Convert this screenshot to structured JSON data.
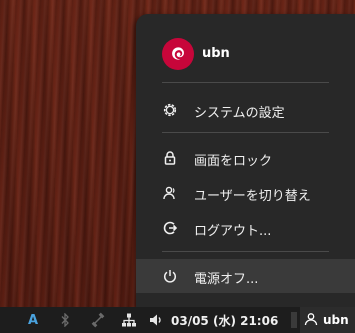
{
  "menu": {
    "user": {
      "name": "ubn",
      "avatar_icon": "debian-swirl-icon",
      "avatar_color": "#c7063a"
    },
    "items": [
      {
        "label": "システムの設定",
        "icon": "settings-gear-icon"
      },
      {
        "label": "画面をロック",
        "icon": "lock-icon"
      },
      {
        "label": "ユーザーを切り替え",
        "icon": "switch-user-icon"
      },
      {
        "label": "ログアウト...",
        "icon": "logout-icon"
      },
      {
        "label": "電源オフ...",
        "icon": "power-icon",
        "highlighted": true
      }
    ]
  },
  "taskbar": {
    "keyboard_indicator": "A",
    "clock": "03/05 (水) 21:06",
    "user_name": "ubn",
    "icons": [
      "bluetooth-icon",
      "wired-disconnected-icon",
      "network-icon",
      "volume-icon",
      "user-icon"
    ]
  },
  "colors": {
    "accent_blue": "#4aa3df",
    "menu_bg": "#282828",
    "taskbar_bg": "#1d1d1d"
  }
}
